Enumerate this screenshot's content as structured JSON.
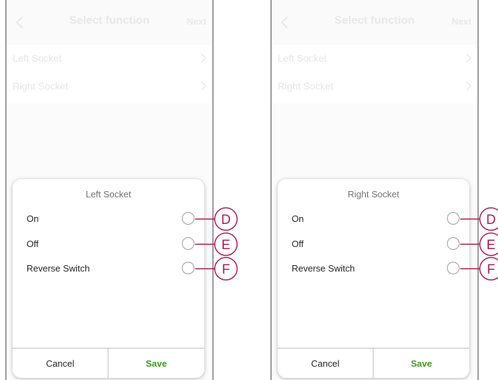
{
  "colors": {
    "callout": "#a3174f",
    "save": "#3a9a1c",
    "faded_text": "#e6e6e6"
  },
  "screens": [
    {
      "header": {
        "back_icon": "chevron-left-icon",
        "title": "Select function",
        "next_label": "Next"
      },
      "rows": [
        {
          "label": "Left Socket",
          "icon": "chevron-right-icon"
        },
        {
          "label": "Right Socket",
          "icon": "chevron-right-icon"
        }
      ],
      "sheet": {
        "title": "Left Socket",
        "options": [
          {
            "label": "On",
            "selected": false
          },
          {
            "label": "Off",
            "selected": false
          },
          {
            "label": "Reverse Switch",
            "selected": false
          }
        ],
        "cancel_label": "Cancel",
        "save_label": "Save"
      }
    },
    {
      "header": {
        "back_icon": "chevron-left-icon",
        "title": "Select function",
        "next_label": "Next"
      },
      "rows": [
        {
          "label": "Left Socket",
          "icon": "chevron-right-icon"
        },
        {
          "label": "Right Socket",
          "icon": "chevron-right-icon"
        }
      ],
      "sheet": {
        "title": "Right Socket",
        "options": [
          {
            "label": "On",
            "selected": false
          },
          {
            "label": "Off",
            "selected": false
          },
          {
            "label": "Reverse Switch",
            "selected": false
          }
        ],
        "cancel_label": "Cancel",
        "save_label": "Save"
      }
    }
  ],
  "callouts": [
    "D",
    "E",
    "F"
  ]
}
